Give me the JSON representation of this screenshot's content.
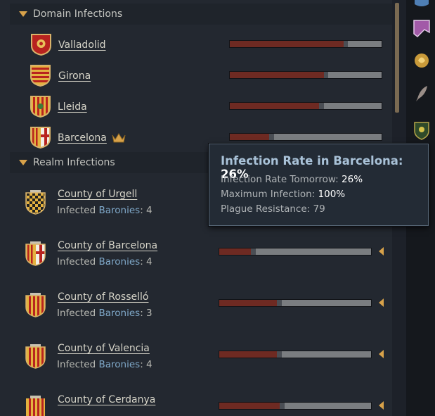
{
  "domain_section": {
    "title": "Domain Infections",
    "items": [
      {
        "name": "Valladolid",
        "infection": 0.75,
        "has_crown": false
      },
      {
        "name": "Girona",
        "infection": 0.62,
        "has_crown": false
      },
      {
        "name": "Lleida",
        "infection": 0.59,
        "has_crown": false
      },
      {
        "name": "Barcelona",
        "infection": 0.26,
        "has_crown": true
      }
    ]
  },
  "realm_section": {
    "title": "Realm Infections",
    "items": [
      {
        "name": "County of Urgell",
        "sub_prefix": "Infected ",
        "sub_link": "Baronies",
        "sub_suffix": ": 4",
        "infection": null
      },
      {
        "name": "County of Barcelona",
        "sub_prefix": "Infected ",
        "sub_link": "Baronies",
        "sub_suffix": ": 4",
        "infection": 0.21
      },
      {
        "name": "County of Rosselló",
        "sub_prefix": "Infected ",
        "sub_link": "Baronies",
        "sub_suffix": ": 3",
        "infection": 0.38
      },
      {
        "name": "County of Valencia",
        "sub_prefix": "Infected ",
        "sub_link": "Baronies",
        "sub_suffix": ": 4",
        "infection": 0.38
      },
      {
        "name": "County of Cerdanya",
        "sub_prefix": "",
        "sub_link": "",
        "sub_suffix": "",
        "infection": 0.4
      }
    ]
  },
  "tooltip": {
    "title_prefix": "Infection Rate in Barcelona: ",
    "title_value": "26%",
    "lines": [
      {
        "label": "Infection Rate Tomorrow: ",
        "value": "26%"
      },
      {
        "label": "Maximum Infection: ",
        "value": "100%"
      },
      {
        "label": "Plague Resistance: ",
        "value": "79"
      }
    ]
  },
  "colors": {
    "accent_gold": "#d8a24a",
    "infection_fill": "#6e2a22",
    "bar_track": "#7a7d80",
    "link_blue": "#7fa8c8"
  },
  "sidebar_icons": [
    "character-icon",
    "banner-icon",
    "rose-icon",
    "quill-icon",
    "shield-icon"
  ]
}
